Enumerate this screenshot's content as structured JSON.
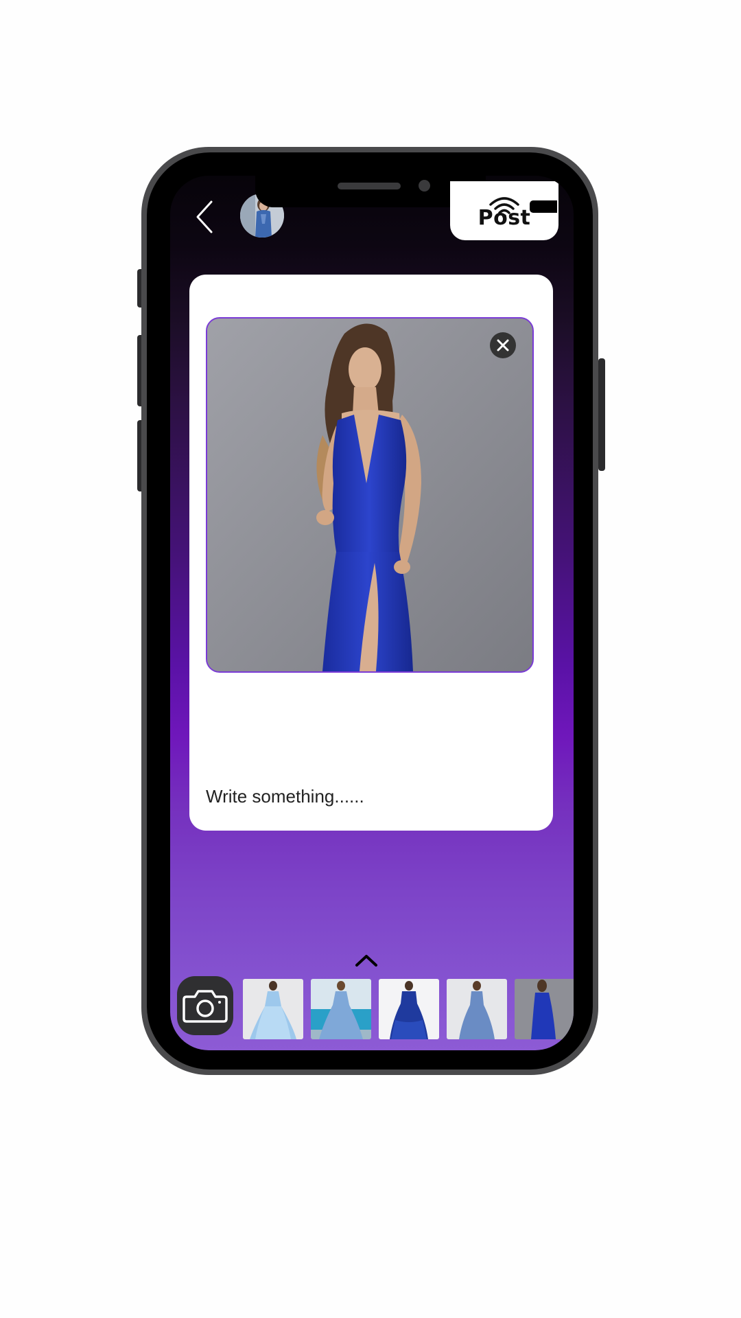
{
  "top_bar": {
    "post_label": "Post"
  },
  "card": {
    "caption_placeholder": "Write something......"
  },
  "icons": {
    "back": "chevron-left-icon",
    "close": "close-icon",
    "expand": "chevron-up-icon",
    "camera": "camera-icon",
    "wifi": "wifi-icon",
    "battery": "battery-icon"
  },
  "colors": {
    "accent": "#7a3ad6",
    "dress_blue": "#2036b8",
    "gradient_top": "#07040a",
    "gradient_mid": "#5a12a6",
    "gradient_bottom": "#8d5bd5"
  }
}
